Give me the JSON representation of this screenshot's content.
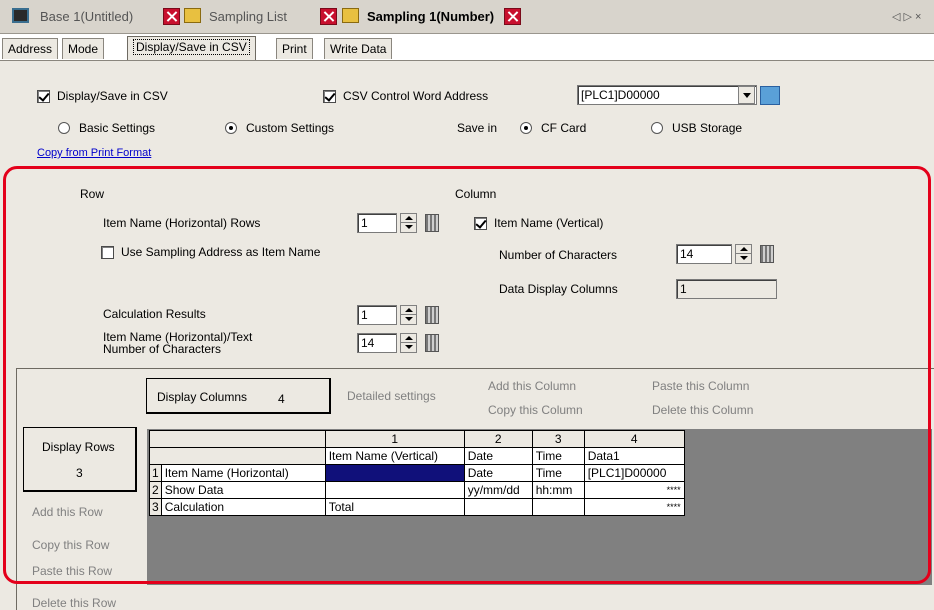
{
  "tabs": [
    {
      "label": "Base 1(Untitled)"
    },
    {
      "label": "Sampling List"
    },
    {
      "label": "Sampling 1(Number)"
    }
  ],
  "scroll_arrows": "◁ ▷ ×",
  "subtabs": [
    "Address",
    "Mode",
    "Display/Save in CSV",
    "Print",
    "Write Data"
  ],
  "top": {
    "display_save_csv": "Display/Save in CSV",
    "csv_control_word": "CSV Control Word Address",
    "csv_address_value": "[PLC1]D00000",
    "basic_settings": "Basic Settings",
    "custom_settings": "Custom Settings",
    "save_in": "Save in",
    "cf_card": "CF Card",
    "usb_storage": "USB Storage",
    "copy_from_print": "Copy from Print Format"
  },
  "row": {
    "heading": "Row",
    "item_name_rows_label": "Item Name (Horizontal) Rows",
    "item_name_rows_value": "1",
    "use_sampling_label": "Use Sampling Address as Item Name",
    "calc_results_label": "Calculation Results",
    "calc_results_value": "1",
    "text_chars_label_1": "Item Name (Horizontal)/Text",
    "text_chars_label_2": "Number of Characters",
    "text_chars_value": "14"
  },
  "column": {
    "heading": "Column",
    "item_name_vertical_label": "Item Name (Vertical)",
    "num_chars_label": "Number of Characters",
    "num_chars_value": "14",
    "data_display_cols_label": "Data Display Columns",
    "data_display_cols_value": "1"
  },
  "editor": {
    "display_columns_label": "Display Columns",
    "display_columns_value": "4",
    "detailed_settings": "Detailed settings",
    "add_column": "Add this Column",
    "copy_column": "Copy this Column",
    "paste_column": "Paste this Column",
    "delete_column": "Delete this Column",
    "display_rows_label": "Display Rows",
    "display_rows_value": "3",
    "add_row": "Add this Row",
    "copy_row": "Copy this Row",
    "paste_row": "Paste this Row",
    "delete_row": "Delete this Row"
  },
  "grid": {
    "col_numbers": [
      "1",
      "2",
      "3",
      "4"
    ],
    "col_names": [
      "Item Name (Vertical)",
      "Date",
      "Time",
      "Data1"
    ],
    "rows": [
      {
        "num": "1",
        "label": "Item Name (Horizontal)",
        "cells": [
          "",
          "Date",
          "Time",
          "[PLC1]D00000"
        ]
      },
      {
        "num": "2",
        "label": "Show Data",
        "cells": [
          "",
          "yy/mm/dd",
          "hh:mm",
          "****"
        ]
      },
      {
        "num": "3",
        "label": "Calculation",
        "cells": [
          "Total",
          "",
          "",
          "****"
        ]
      }
    ]
  },
  "colors": {
    "highlight": "#e4001b",
    "selected_cell": "#10107a",
    "link": "#0000cc"
  }
}
